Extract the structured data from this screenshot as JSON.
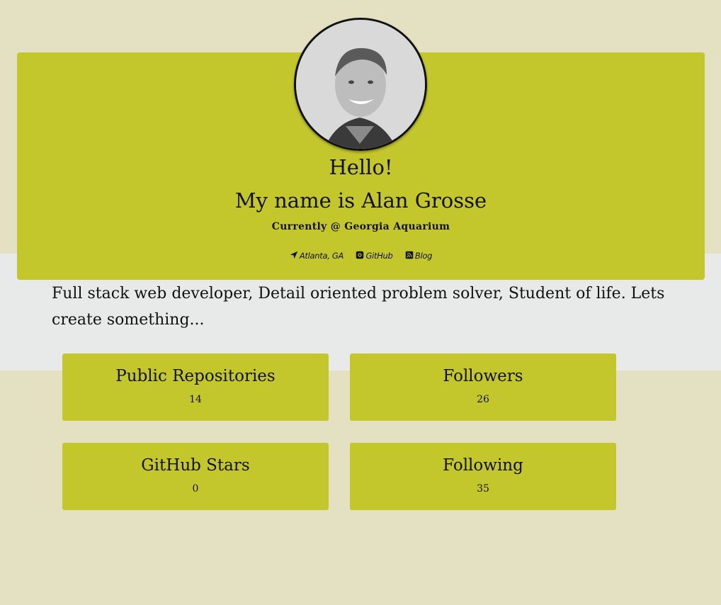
{
  "header": {
    "greeting": "Hello!",
    "name_line": "My name is Alan Grosse",
    "current": "Currently @ Georgia Aquarium",
    "links": [
      {
        "label": "Atlanta, GA",
        "icon": "location-arrow-icon"
      },
      {
        "label": "GitHub",
        "icon": "github-icon"
      },
      {
        "label": "Blog",
        "icon": "rss-icon"
      }
    ]
  },
  "bio": "Full stack web developer, Detail oriented problem solver, Student of life. Lets create something...",
  "stats": [
    {
      "label": "Public Repositories",
      "value": "14"
    },
    {
      "label": "Followers",
      "value": "26"
    },
    {
      "label": "GitHub Stars",
      "value": "0"
    },
    {
      "label": "Following",
      "value": "35"
    }
  ],
  "colors": {
    "page_background": "#e4e0c2",
    "band_background": "#e8eaea",
    "card_accent": "#c3c72c",
    "text": "#111111"
  }
}
